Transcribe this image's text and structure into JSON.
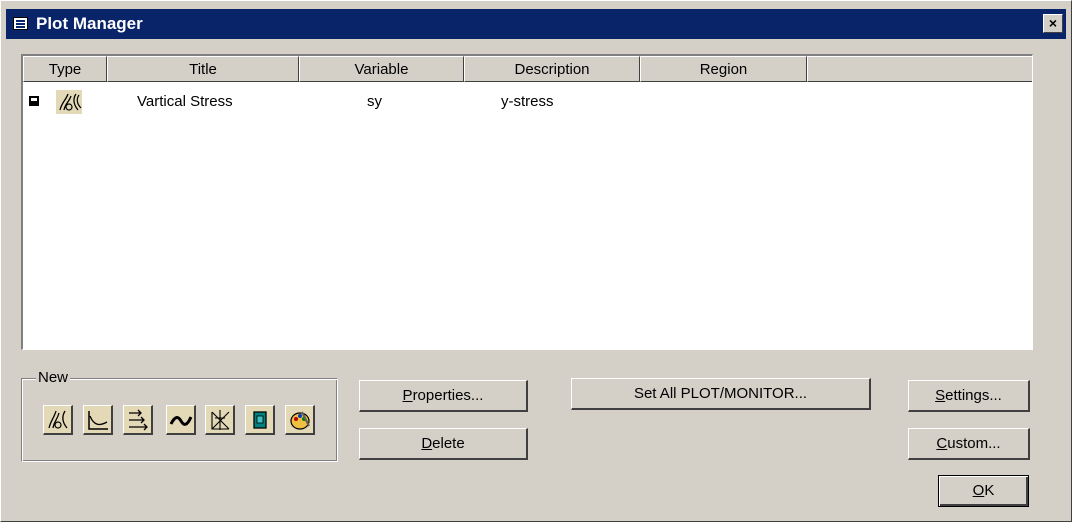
{
  "window": {
    "title": "Plot Manager",
    "close_label": "×"
  },
  "table": {
    "columns": [
      "Type",
      "Title",
      "Variable",
      "Description",
      "Region"
    ],
    "rows": [
      {
        "type_icon": "contour-plot-icon",
        "title": "Vartical Stress",
        "variable": "sy",
        "description": "y-stress",
        "region": ""
      }
    ]
  },
  "new_group": {
    "label": "New",
    "tools": [
      "contour-plot-icon",
      "graph-plot-icon",
      "vector-plot-icon",
      "curve-plot-icon",
      "mesh-plot-icon",
      "text-plot-icon",
      "palette-plot-icon"
    ]
  },
  "buttons": {
    "properties": {
      "mnemonic": "P",
      "rest": "roperties..."
    },
    "delete": {
      "mnemonic": "D",
      "rest": "elete"
    },
    "set_all": "Set All PLOT/MONITOR...",
    "settings": {
      "mnemonic": "S",
      "rest": "ettings..."
    },
    "custom": {
      "mnemonic": "C",
      "rest": "ustom..."
    },
    "ok": {
      "mnemonic": "O",
      "rest": "K"
    }
  }
}
